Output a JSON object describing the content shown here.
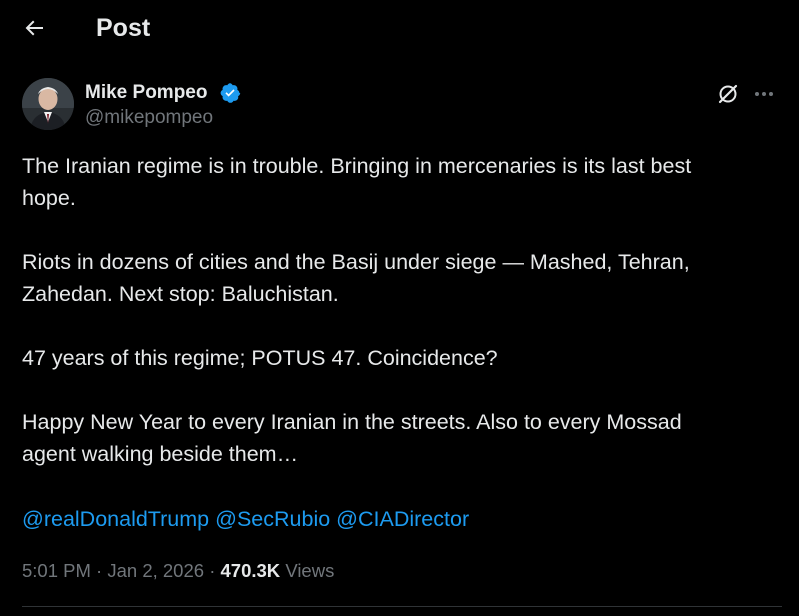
{
  "header": {
    "title": "Post",
    "back_icon": "arrow-left-icon"
  },
  "author": {
    "name": "Mike Pompeo",
    "handle": "@mikepompeo",
    "verified_icon": "verified-badge-icon",
    "verified_color": "#1d9bf0"
  },
  "actions": {
    "grok_icon": "grok-icon",
    "more_icon": "more-horizontal-icon"
  },
  "tweet": {
    "paragraphs": [
      "The Iranian regime is in trouble. Bringing in mercenaries is its last best\nhope.",
      "Riots in dozens of cities and the Basij under siege — Mashed, Tehran,\nZahedan.  Next stop:  Baluchistan.",
      "47 years of this regime; POTUS 47.  Coincidence?",
      "Happy New Year to every Iranian in the streets.  Also to every Mossad\nagent walking beside them…"
    ],
    "mentions": [
      "@realDonaldTrump",
      "@SecRubio",
      "@CIADirector"
    ],
    "mention_color": "#1d9bf0"
  },
  "meta": {
    "time": "5:01 PM",
    "separator": "·",
    "date": "Jan 2, 2026",
    "views_count": "470.3K",
    "views_label": "Views"
  },
  "colors": {
    "background": "#000000",
    "text": "#e7e9ea",
    "secondary": "#71767b",
    "divider": "#2f3336"
  }
}
